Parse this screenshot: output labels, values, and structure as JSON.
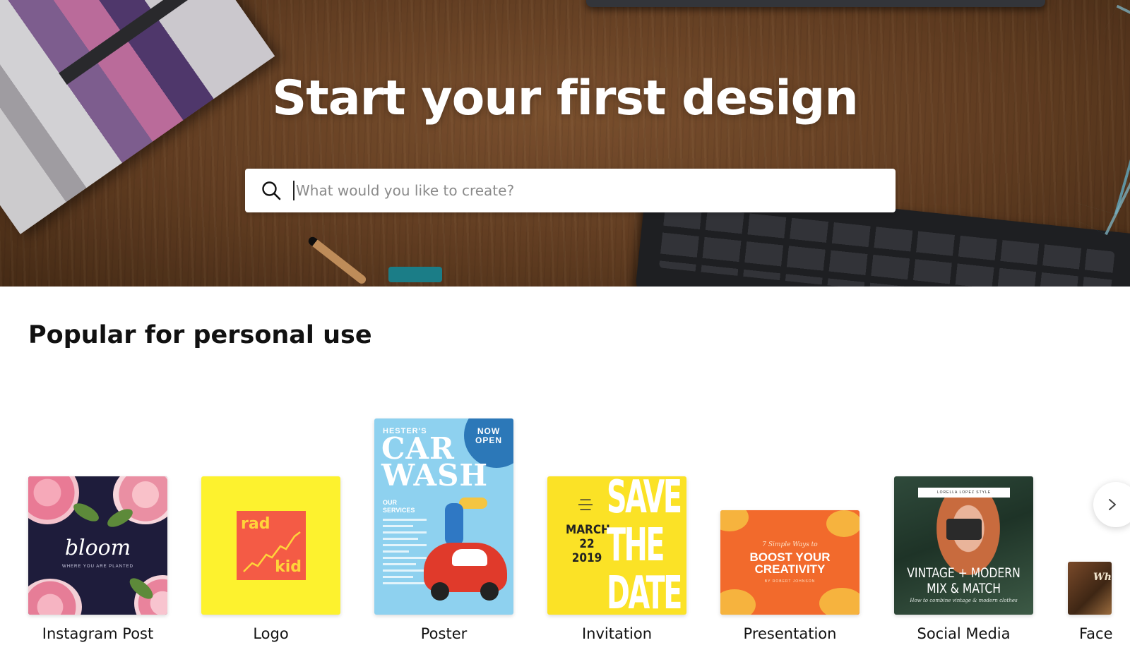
{
  "hero": {
    "title": "Start your first design",
    "search": {
      "placeholder": "What would you like to create?",
      "value": "",
      "icon": "search-icon"
    }
  },
  "section": {
    "title": "Popular for personal use",
    "cards": [
      {
        "label": "Instagram Post",
        "thumb_text": "bloom",
        "thumb_subtext": "WHERE YOU ARE PLANTED"
      },
      {
        "label": "Logo",
        "thumb_text_top": "rad",
        "thumb_text_bottom": "kid"
      },
      {
        "label": "Poster",
        "thumb_badge": "NOW OPEN",
        "thumb_brand": "HESTER'S",
        "thumb_title": "CAR WASH",
        "thumb_section": "OUR SERVICES"
      },
      {
        "label": "Invitation",
        "thumb_date": "MARCH 22 2019",
        "thumb_title": "SAVE THE DATE"
      },
      {
        "label": "Presentation",
        "thumb_kicker": "7 Simple Ways to",
        "thumb_title": "BOOST YOUR CREATIVITY",
        "thumb_byline": "BY ROBERT JOHNSON"
      },
      {
        "label": "Social Media",
        "thumb_header": "LORELLA LOPEZ STYLE",
        "thumb_title": "VINTAGE + MODERN MIX & MATCH",
        "thumb_sub": "How to combine vintage & modern clothes"
      },
      {
        "label": "Face",
        "thumb_text": "Wh"
      }
    ],
    "next_icon": "chevron-right-icon"
  },
  "colors": {
    "logo_bg": "#fdf22e",
    "logo_square": "#f45b45",
    "poster_bg": "#8ed1ef",
    "invite_bg": "#fbe226",
    "pres_bg": "#f26a2c",
    "insta_bg": "#1e1c3b"
  }
}
